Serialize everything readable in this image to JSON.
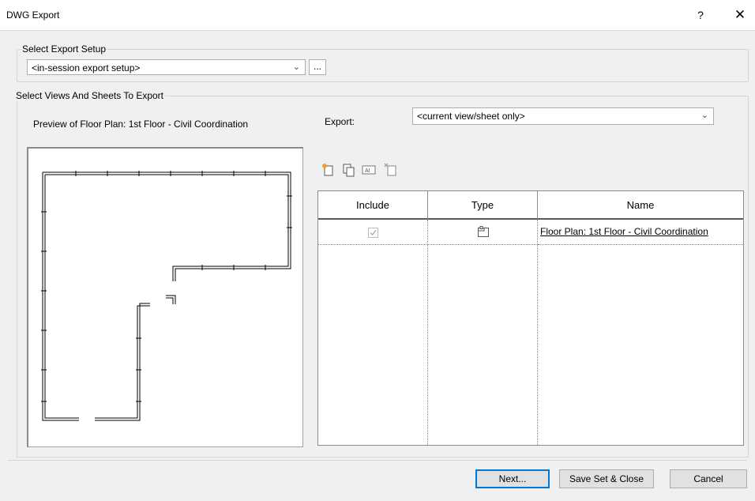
{
  "window": {
    "title": "DWG Export",
    "help": "?",
    "close": "✕"
  },
  "export_setup": {
    "group_label": "Select Export Setup",
    "selected": "<in-session export setup>",
    "more_button": "..."
  },
  "views": {
    "group_label": "Select Views And Sheets To Export",
    "preview_label": "Preview of Floor Plan: 1st Floor - Civil Coordination",
    "export_label": "Export:",
    "export_selected": "<current view/sheet only>"
  },
  "toolbar": {
    "icons": [
      "new-set-icon",
      "duplicate-set-icon",
      "rename-set-icon",
      "delete-set-icon"
    ]
  },
  "table": {
    "columns": [
      "Include",
      "Type",
      "Name"
    ],
    "rows": [
      {
        "include": true,
        "type_icon": "view-type-icon",
        "name": "Floor Plan: 1st Floor - Civil Coordination"
      }
    ]
  },
  "buttons": {
    "next": "Next...",
    "save_close": "Save Set & Close",
    "cancel": "Cancel"
  },
  "colors": {
    "accent": "#0078d7",
    "background": "#f0f0f0"
  }
}
